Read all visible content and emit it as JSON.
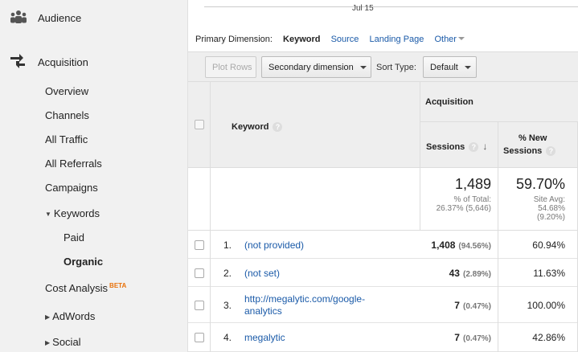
{
  "sidebar": {
    "audience": "Audience",
    "acquisition": "Acquisition",
    "items": {
      "overview": "Overview",
      "channels": "Channels",
      "all_traffic": "All Traffic",
      "all_referrals": "All Referrals",
      "campaigns": "Campaigns",
      "keywords": "Keywords",
      "paid": "Paid",
      "organic": "Organic",
      "cost_analysis": "Cost Analysis",
      "beta": "BETA",
      "adwords": "AdWords",
      "social": "Social"
    }
  },
  "chart": {
    "x_label": "Jul 15"
  },
  "dimensions": {
    "label": "Primary Dimension:",
    "active": "Keyword",
    "source": "Source",
    "landing_page": "Landing Page",
    "other": "Other"
  },
  "toolbar": {
    "plot_rows": "Plot Rows",
    "secondary_dimension": "Secondary dimension",
    "sort_type_label": "Sort Type:",
    "sort_type_value": "Default"
  },
  "table": {
    "headers": {
      "keyword": "Keyword",
      "group": "Acquisition",
      "sessions": "Sessions",
      "new_sessions_line1": "% New",
      "new_sessions_line2": "Sessions",
      "help": "?"
    },
    "summary": {
      "sessions": "1,489",
      "sessions_sub1": "% of Total:",
      "sessions_sub2": "26.37% (5,646)",
      "new": "59.70%",
      "new_sub1": "Site Avg:",
      "new_sub2": "54.68%",
      "new_sub3": "(9.20%)"
    },
    "rows": [
      {
        "num": "1.",
        "keyword": "(not provided)",
        "sessions": "1,408",
        "pct": "(94.56%)",
        "new": "60.94%"
      },
      {
        "num": "2.",
        "keyword": "(not set)",
        "sessions": "43",
        "pct": "(2.89%)",
        "new": "11.63%"
      },
      {
        "num": "3.",
        "keyword_line1": "http://megalytic.com/google-",
        "keyword_line2": "analytics",
        "sessions": "7",
        "pct": "(0.47%)",
        "new": "100.00%"
      },
      {
        "num": "4.",
        "keyword": "megalytic",
        "sessions": "7",
        "pct": "(0.47%)",
        "new": "42.86%"
      }
    ]
  },
  "colors": {
    "link": "#1a5aa8",
    "beta": "#e8710a"
  }
}
